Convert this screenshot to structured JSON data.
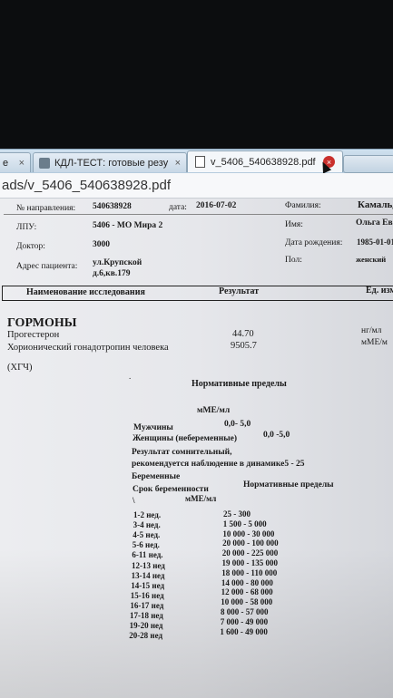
{
  "browser": {
    "tabs": [
      {
        "title": "e",
        "close": "×"
      },
      {
        "title": "КДЛ-ТЕСТ: готовые резу",
        "close": "×"
      },
      {
        "title": "v_5406_540638928.pdf",
        "close": "×"
      }
    ],
    "address": "ads/v_5406_540638928.pdf"
  },
  "header": {
    "order_label": "№ направления:",
    "order_value": "540638928",
    "date_label": "дата:",
    "date_value": "2016-07-02",
    "surname_label": "Фамилия:",
    "surname_value": "Камальд",
    "lpu_label": "ЛПУ:",
    "lpu_value": "5406 - МО Мира 2",
    "name_label": "Имя:",
    "name_value": "Ольга Ев",
    "doctor_label": "Доктор:",
    "doctor_value": "3000",
    "dob_label": "Дата рождения:",
    "dob_value": "1985-01-01",
    "address_label": "Адрес пациента:",
    "address_line1": "ул.Крупской",
    "address_line2": "д.6,кв.179",
    "sex_label": "Пол:",
    "sex_value": "женский"
  },
  "table_header": {
    "col_name": "Наименование исследования",
    "col_result": "Результат",
    "col_unit": "Ед. изм"
  },
  "section": {
    "title": "ГОРМОНЫ",
    "tests": [
      {
        "name": "Прогестерон",
        "value": "44.70",
        "unit": "нг/мл"
      },
      {
        "name": "Хорионический гонадотропин человека",
        "name_cont": "(ХГЧ)",
        "value": "9505.7",
        "unit": "мМЕ/м"
      }
    ]
  },
  "norms": {
    "title": "Нормативные пределы",
    "unit": "мМЕ/мл",
    "men_label": "Мужчины",
    "men_value": "0,0- 5,0",
    "women_label": "Женщины (небеременные)",
    "women_value": "0,0 -5,0",
    "note1": "Результат сомнительный,",
    "note2": "рекомендуется наблюдение в динамике5 - 25",
    "pregnant": "Беременные",
    "term_header": "Срок беременности",
    "norm_header": "Нормативные пределы",
    "slash": "\\",
    "unit2": "мМЕ/мл",
    "rows": [
      {
        "term": "1-2 нед.",
        "range": "25 - 300"
      },
      {
        "term": "3-4 нед.",
        "range": "1 500 - 5 000"
      },
      {
        "term": "4-5 нед.",
        "range": "10 000 - 30 000"
      },
      {
        "term": "5-6 нед.",
        "range": "20 000 - 100 000"
      },
      {
        "term": "6-11 нед.",
        "range": "20 000 - 225 000"
      },
      {
        "term": "12-13 нед",
        "range": "19 000 - 135 000"
      },
      {
        "term": "13-14 нед",
        "range": "18 000 - 110 000"
      },
      {
        "term": "14-15 нед",
        "range": "14 000 - 80 000"
      },
      {
        "term": "15-16 нед",
        "range": "12 000 - 68 000"
      },
      {
        "term": "16-17 нед",
        "range": "10 000 - 58 000"
      },
      {
        "term": "17-18 нед",
        "range": "8 000 - 57 000"
      },
      {
        "term": "19-20 нед",
        "range": "7 000 - 49 000"
      },
      {
        "term": "20-28 нед",
        "range": "1 600 - 49 000"
      }
    ]
  }
}
